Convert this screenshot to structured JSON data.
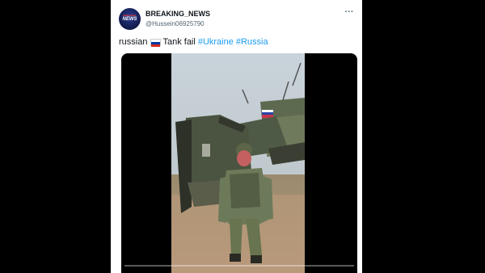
{
  "tweet": {
    "author": {
      "display_name": "BREAKING_NEWS",
      "handle": "@Hussein06925790",
      "avatar_text_top": "BREAKING",
      "avatar_text_main": "NEWS"
    },
    "text_prefix": "russian",
    "flag_emoji": "russia-flag-icon",
    "text_main": "Tank fail",
    "hashtags": [
      "#Ukraine",
      "#Russia"
    ],
    "more_icon": "more-icon"
  },
  "video": {
    "progress_fraction": 0
  },
  "colors": {
    "link": "#1d9bf0",
    "text": "#0f1419",
    "muted": "#536471",
    "background": "#000000"
  }
}
